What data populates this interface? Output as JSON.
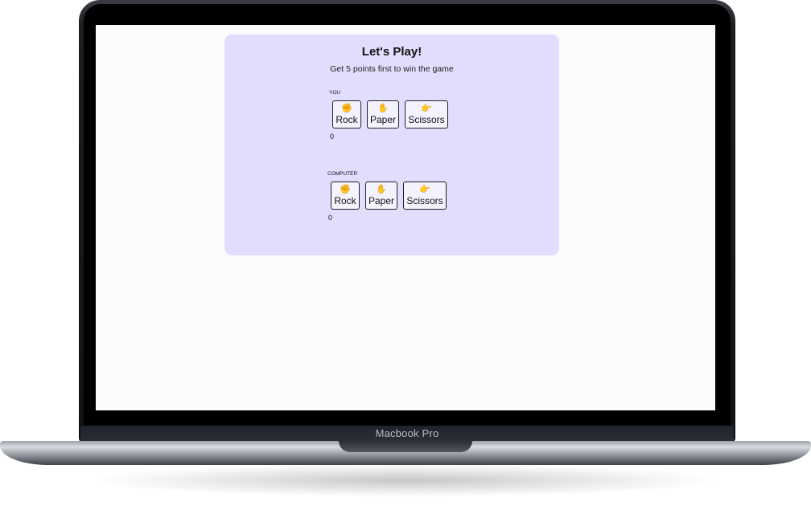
{
  "device": {
    "brand_label": "Macbook Pro"
  },
  "game": {
    "title": "Let's Play!",
    "subtitle": "Get 5 points first to win the game",
    "players": [
      {
        "label": "YOU",
        "score": "0",
        "choices": [
          {
            "icon": "fist-icon",
            "glyph": "✊",
            "label": "Rock"
          },
          {
            "icon": "hand-icon",
            "glyph": "✋",
            "label": "Paper"
          },
          {
            "icon": "scissors-hand-icon",
            "glyph": "👉",
            "label": "Scissors"
          }
        ]
      },
      {
        "label": "COMPUTER",
        "score": "0",
        "choices": [
          {
            "icon": "fist-icon",
            "glyph": "✊",
            "label": "Rock"
          },
          {
            "icon": "hand-icon",
            "glyph": "✋",
            "label": "Paper"
          },
          {
            "icon": "scissors-hand-icon",
            "glyph": "👉",
            "label": "Scissors"
          }
        ]
      }
    ]
  },
  "colors": {
    "card_background": "#e1ddfc",
    "screen_background": "#fcfcfc"
  }
}
